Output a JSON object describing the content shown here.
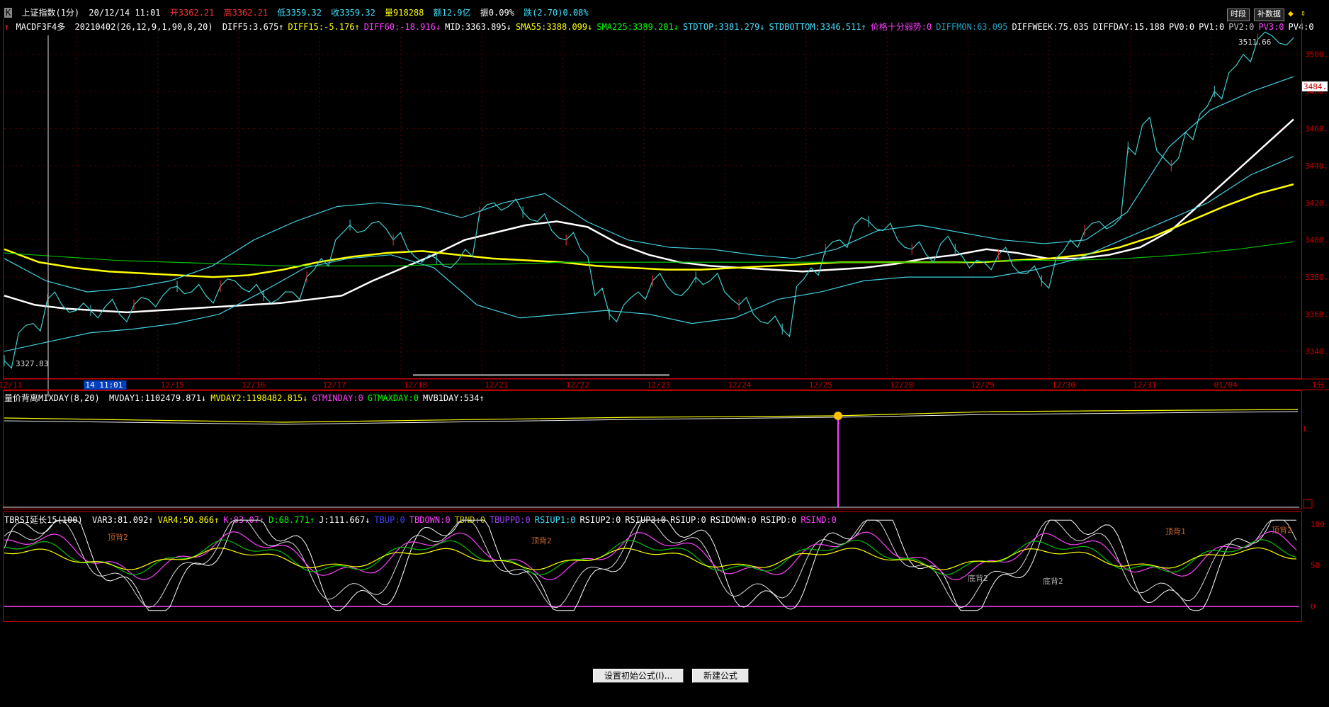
{
  "header": {
    "close_glyph": "K",
    "index_name": "上证指数(1分)",
    "datetime": "20/12/14 11:01",
    "open": "开3362.21",
    "high": "高3362.21",
    "low": "低3359.32",
    "close": "收3359.32",
    "volume": "量918288",
    "amount": "额12.9亿",
    "amplitude": "振0.09%",
    "change": "跌(2.70)0.08%",
    "btn_period": "时段",
    "btn_data": "补数据"
  },
  "main_indicator": {
    "name": "MACDF3F4多",
    "params": "20210402(26,12,9,1,90,8,20)",
    "items": [
      {
        "text": "DIFF5:3.675↑",
        "color": "#ffffff"
      },
      {
        "text": "DIFF15:-5.176↑",
        "color": "#ffff00"
      },
      {
        "text": "DIFF60:-18.916↓",
        "color": "#ff40ff"
      },
      {
        "text": "MID:3363.895↓",
        "color": "#ffffff"
      },
      {
        "text": "SMA55:3388.099↓",
        "color": "#ffff00"
      },
      {
        "text": "SMA225:3389.201↓",
        "color": "#00ff00"
      },
      {
        "text": "STDTOP:3381.279↓",
        "color": "#40e0ff"
      },
      {
        "text": "STDBOTTOM:3346.511↑",
        "color": "#40e0ff"
      },
      {
        "text": "价格十分弱势:0",
        "color": "#ff40ff"
      },
      {
        "text": "DIFFMON:63.095",
        "color": "#20a0c0"
      },
      {
        "text": "DIFFWEEK:75.035",
        "color": "#ffffff"
      },
      {
        "text": "DIFFDAY:15.188",
        "color": "#ffffff"
      },
      {
        "text": "PV0:0",
        "color": "#ffffff"
      },
      {
        "text": "PV1:0",
        "color": "#ffffff"
      },
      {
        "text": "PV2:0",
        "color": "#c0c0c0"
      },
      {
        "text": "PV3:0",
        "color": "#ff40ff"
      },
      {
        "text": "PV4:0",
        "color": "#ffffff"
      }
    ]
  },
  "volume_indicator": {
    "name": "量价背离MIXDAY(8,20)",
    "items": [
      {
        "text": "MVDAY1:1102479.871↓",
        "color": "#ffffff"
      },
      {
        "text": "MVDAY2:1198482.815↓",
        "color": "#ffff00"
      },
      {
        "text": "GTMINDAY:0",
        "color": "#ff40ff"
      },
      {
        "text": "GTMAXDAY:0",
        "color": "#00ff00"
      },
      {
        "text": "MVB1DAY:534↑",
        "color": "#ffffff"
      }
    ]
  },
  "rsi_indicator": {
    "name": "TBRSI延长15(100)",
    "items": [
      {
        "text": "VAR3:81.092↑",
        "color": "#ffffff"
      },
      {
        "text": "VAR4:50.866↑",
        "color": "#ffff00"
      },
      {
        "text": "K:83.07↑",
        "color": "#ff40ff"
      },
      {
        "text": "D:68.771↑",
        "color": "#00ff00"
      },
      {
        "text": "J:111.667↓",
        "color": "#ffffff"
      },
      {
        "text": "TBUP:0",
        "color": "#4040ff"
      },
      {
        "text": "TBDOWN:0",
        "color": "#ff40ff"
      },
      {
        "text": "TBND:0",
        "color": "#c0c000"
      },
      {
        "text": "TBUPPD:0",
        "color": "#a040ff"
      },
      {
        "text": "RSIUP1:0",
        "color": "#40e0ff"
      },
      {
        "text": "RSIUP2:0",
        "color": "#ffffff"
      },
      {
        "text": "RSIUP3:0",
        "color": "#ffffff"
      },
      {
        "text": "RSIUP:0",
        "color": "#ffffff"
      },
      {
        "text": "RSIDOWN:0",
        "color": "#ffffff"
      },
      {
        "text": "RSIPD:0",
        "color": "#ffffff"
      },
      {
        "text": "RSIND:0",
        "color": "#ff40ff"
      }
    ],
    "annotations": [
      "顶背2",
      "顶背2",
      "顶背1",
      "顶背2",
      "底背2",
      "底背2"
    ]
  },
  "buttons": {
    "set_formula": "设置初始公式(I)...",
    "new_formula": "新建公式(N)"
  },
  "chart_data": {
    "type": "line",
    "period_label": "1分",
    "x_dates": [
      "12/11",
      "12/14",
      "12/15",
      "12/16",
      "12/17",
      "12/18",
      "12/21",
      "12/22",
      "12/23",
      "12/24",
      "12/25",
      "12/28",
      "12/29",
      "12/30",
      "12/31",
      "01/04"
    ],
    "cursor_label": "14 11:01",
    "y_ticks": [
      3340,
      3360,
      3380,
      3400,
      3420,
      3440,
      3460,
      3480,
      3500
    ],
    "ylim": [
      3327,
      3514
    ],
    "current_price_label": "3484.",
    "max_label": "3511.66",
    "min_label": "3327.83",
    "price_close": [
      3335,
      3350,
      3355,
      3368,
      3365,
      3362,
      3362,
      3364,
      3360,
      3365,
      3368,
      3370,
      3375,
      3372,
      3370,
      3375,
      3378,
      3372,
      3370,
      3368,
      3372,
      3380,
      3390,
      3400,
      3408,
      3405,
      3410,
      3400,
      3395,
      3388,
      3390,
      3385,
      3395,
      3415,
      3420,
      3418,
      3415,
      3410,
      3405,
      3400,
      3395,
      3370,
      3360,
      3365,
      3372,
      3378,
      3375,
      3370,
      3380,
      3378,
      3372,
      3365,
      3360,
      3355,
      3352,
      3375,
      3385,
      3395,
      3400,
      3408,
      3410,
      3405,
      3400,
      3395,
      3392,
      3398,
      3395,
      3385,
      3388,
      3392,
      3386,
      3382,
      3378,
      3390,
      3400,
      3405,
      3410,
      3408,
      3450,
      3462,
      3448,
      3440,
      3458,
      3468,
      3480,
      3490,
      3500,
      3508,
      3510,
      3505
    ],
    "series": [
      {
        "name": "MID",
        "color": "#ffffff",
        "values": [
          3370,
          3365,
          3363,
          3362,
          3361,
          3362,
          3363,
          3364,
          3365,
          3366,
          3368,
          3370,
          3378,
          3385,
          3392,
          3400,
          3404,
          3408,
          3410,
          3407,
          3398,
          3392,
          3388,
          3386,
          3385,
          3384,
          3383,
          3384,
          3385,
          3387,
          3390,
          3392,
          3395,
          3393,
          3390,
          3390,
          3392,
          3396,
          3405,
          3420,
          3435,
          3450,
          3465
        ]
      },
      {
        "name": "SMA55",
        "color": "#ffff00",
        "values": [
          3395,
          3388,
          3385,
          3383,
          3382,
          3381,
          3380,
          3381,
          3384,
          3388,
          3391,
          3393,
          3394,
          3392,
          3390,
          3389,
          3388,
          3386,
          3385,
          3384,
          3384,
          3385,
          3386,
          3387,
          3388,
          3388,
          3388,
          3388,
          3388,
          3389,
          3390,
          3392,
          3396,
          3402,
          3410,
          3418,
          3425,
          3430
        ]
      },
      {
        "name": "SMA225",
        "color": "#00c000",
        "values": [
          3393,
          3391,
          3389,
          3388,
          3387,
          3386,
          3386,
          3386,
          3387,
          3387,
          3388,
          3388,
          3388,
          3388,
          3388,
          3388,
          3388,
          3388,
          3389,
          3389,
          3390,
          3392,
          3395,
          3399
        ]
      },
      {
        "name": "STDTOP",
        "color": "#40d0e0",
        "values": [
          3390,
          3378,
          3372,
          3374,
          3378,
          3386,
          3400,
          3410,
          3418,
          3420,
          3418,
          3412,
          3420,
          3425,
          3410,
          3400,
          3396,
          3395,
          3392,
          3390,
          3395,
          3405,
          3408,
          3404,
          3400,
          3398,
          3400,
          3415,
          3450,
          3470,
          3480,
          3488
        ]
      },
      {
        "name": "STDBOTTOM",
        "color": "#40d0e0",
        "values": [
          3340,
          3345,
          3350,
          3352,
          3355,
          3360,
          3372,
          3385,
          3390,
          3392,
          3385,
          3365,
          3358,
          3360,
          3362,
          3360,
          3355,
          3358,
          3368,
          3372,
          3378,
          3380,
          3380,
          3380,
          3384,
          3390,
          3400,
          3410,
          3420,
          3435,
          3445
        ]
      }
    ]
  }
}
